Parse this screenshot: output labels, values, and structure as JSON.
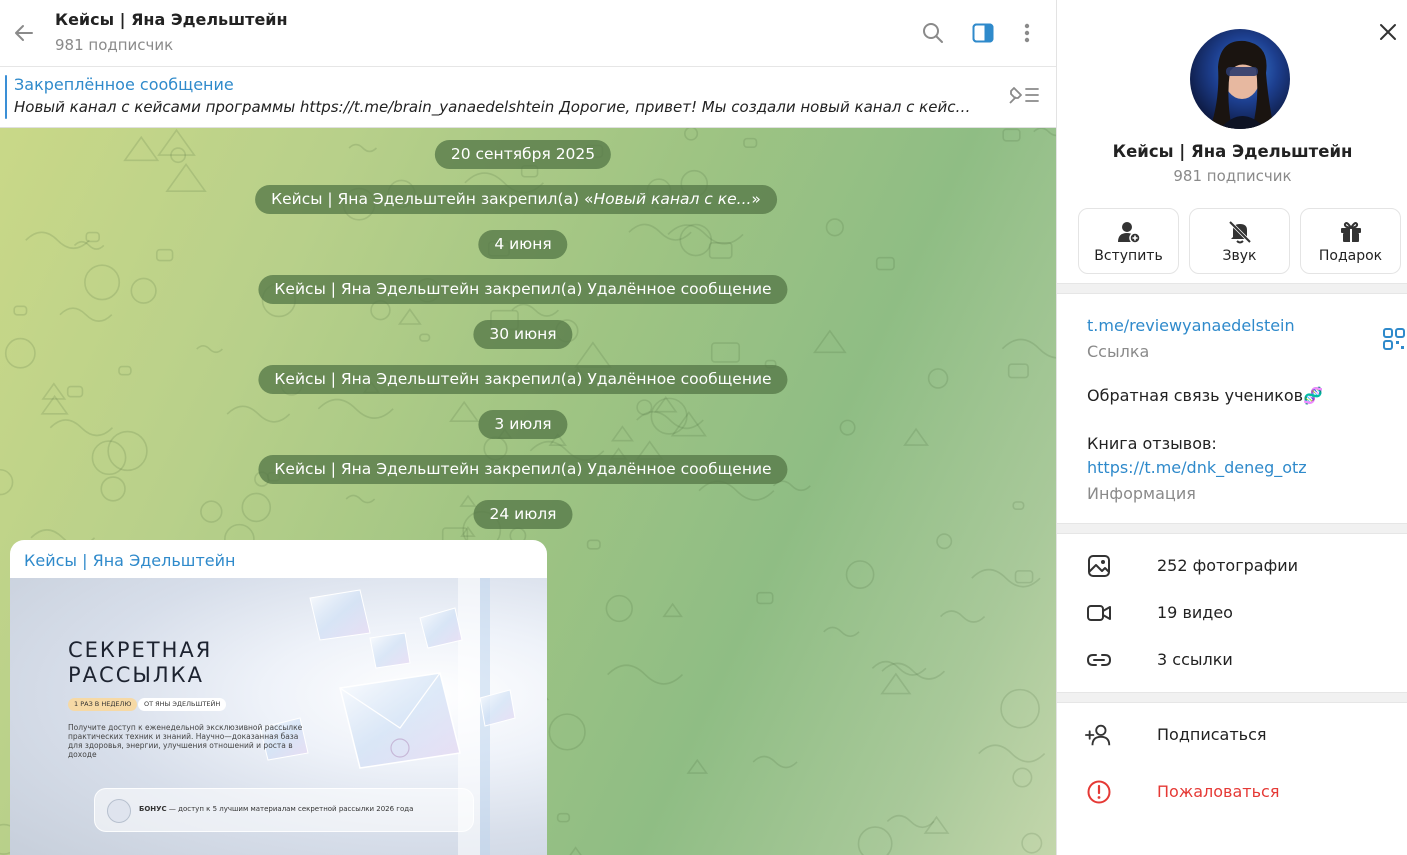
{
  "colors": {
    "accent": "#2f8acb",
    "danger": "#e53935",
    "service_bubble": "#567848"
  },
  "header": {
    "title": "Кейсы | Яна Эдельштейн",
    "subscribers": "981 подписчик",
    "icons": [
      "back-arrow-icon",
      "search-icon",
      "sidebar-toggle-icon",
      "more-vertical-icon"
    ]
  },
  "pinned": {
    "title": "Закреплённое сообщение",
    "text": "Новый канал с кейсами программы https://t.me/brain_yanaedelshtein   Дорогие, привет!  Мы создали новый канал с кейсами, которые помогут вам",
    "icon": "pinned-list-icon"
  },
  "messages": [
    {
      "type": "date",
      "text": "20 сентября 2025"
    },
    {
      "type": "service",
      "prefix": "Кейсы | Яна Эдельштейн закрепил(а) «",
      "italic": "Новый канал с ке...",
      "suffix": "»"
    },
    {
      "type": "date",
      "text": "4 июня"
    },
    {
      "type": "service",
      "text": "Кейсы | Яна Эдельштейн закрепил(а) Удалённое сообщение"
    },
    {
      "type": "date",
      "text": "30 июня"
    },
    {
      "type": "service",
      "text": "Кейсы | Яна Эдельштейн закрепил(а) Удалённое сообщение"
    },
    {
      "type": "date",
      "text": "3 июля"
    },
    {
      "type": "service",
      "text": "Кейсы | Яна Эдельштейн закрепил(а) Удалённое сообщение"
    },
    {
      "type": "date",
      "text": "24 июля"
    }
  ],
  "post": {
    "author": "Кейсы | Яна Эдельштейн",
    "image": {
      "title_line1": "СЕКРЕТНАЯ",
      "title_line2": "РАССЫЛКА",
      "tag1": "1 РАЗ В НЕДЕЛЮ",
      "tag2": "ОТ ЯНЫ ЭДЕЛЬШТЕЙН",
      "description": "Получите доступ к еженедельной эксклюзивной рассылке практических техник и знаний. Научно—доказанная база для здоровья, энергии, улучшения отношений и роста в доходе",
      "bonus_bold": "БОНУС",
      "bonus_text": " — доступ к 5 лучшим материалам секретной рассылки 2026 года"
    }
  },
  "panel": {
    "title": "Кейсы | Яна Эдельштейн",
    "subscribers": "981 подписчик",
    "actions": [
      {
        "label": "Вступить",
        "icon": "person-add-icon"
      },
      {
        "label": "Звук",
        "icon": "bell-off-icon"
      },
      {
        "label": "Подарок",
        "icon": "gift-icon"
      }
    ],
    "link": "t.me/reviewyanaedelstein",
    "link_label": "Ссылка",
    "description_line1": "Обратная связь учеников🧬",
    "description_line2": "Книга отзывов:",
    "description_link": "https://t.me/dnk_deneg_otz",
    "description_label": "Информация",
    "media": [
      {
        "label": "252 фотографии",
        "icon": "photo-icon"
      },
      {
        "label": "19 видео",
        "icon": "video-icon"
      },
      {
        "label": "3 ссылки",
        "icon": "link-icon"
      }
    ],
    "subscribe": "Подписаться",
    "report": "Пожаловаться"
  }
}
